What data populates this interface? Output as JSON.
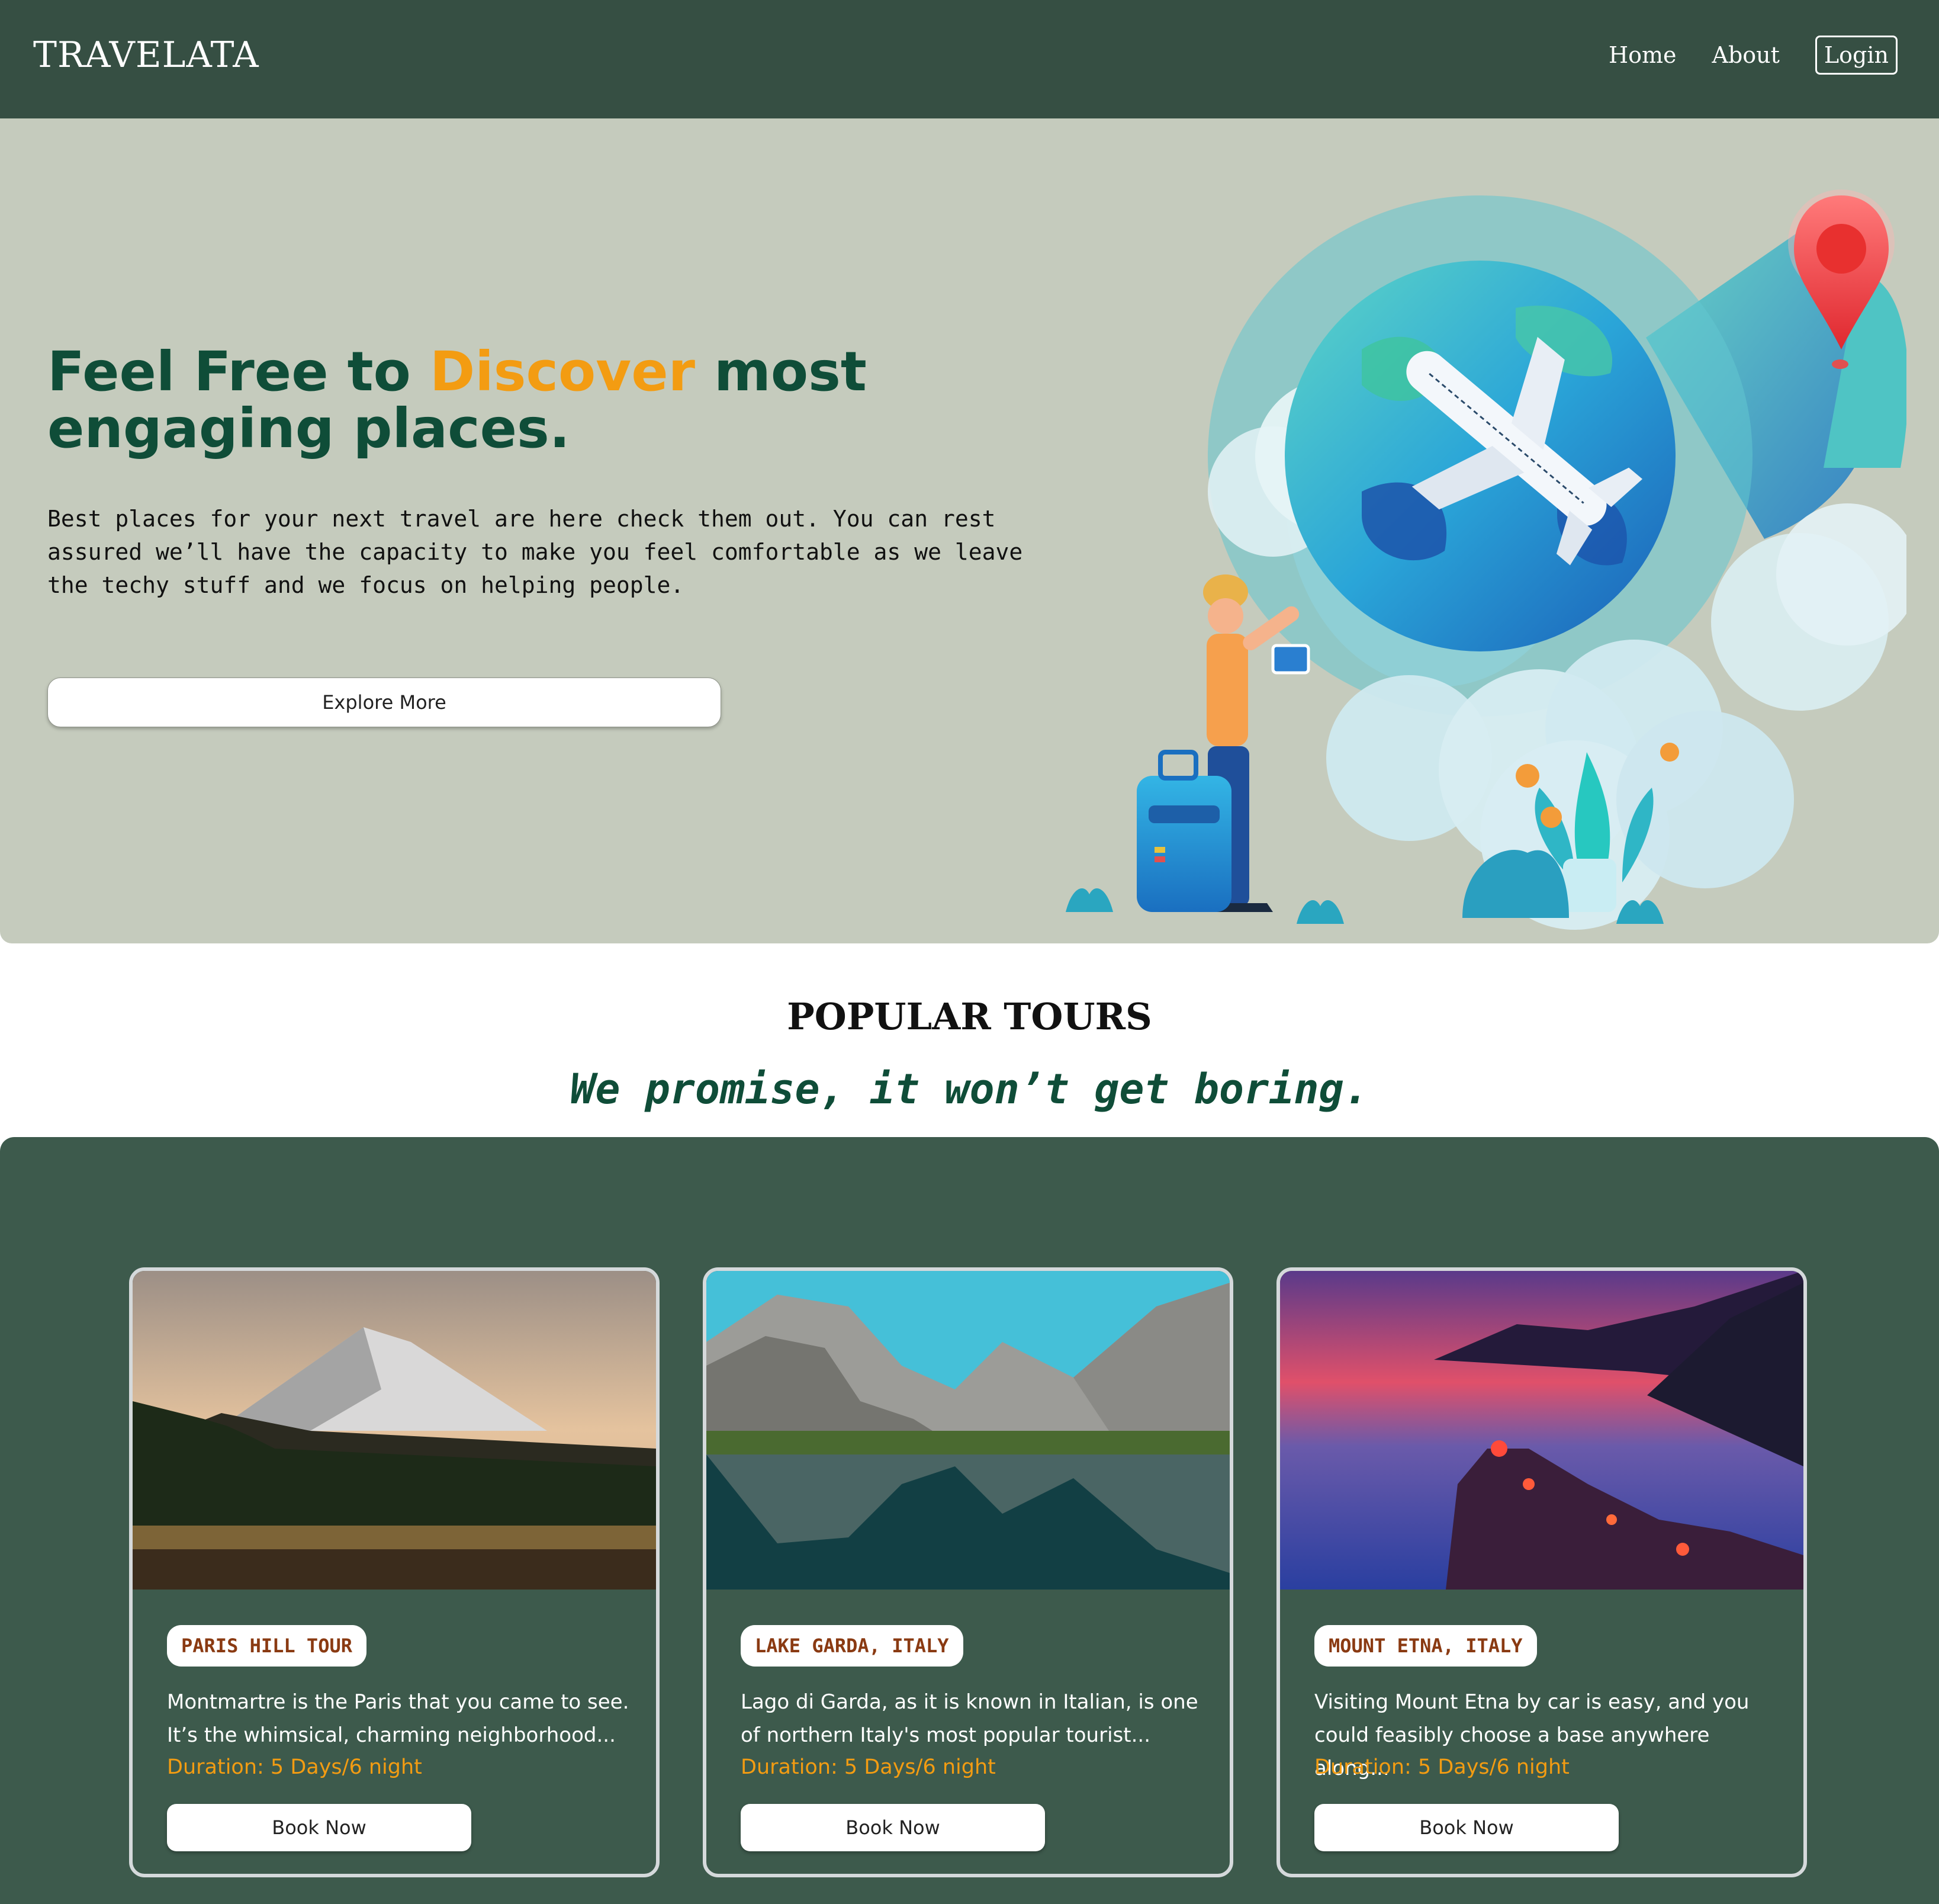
{
  "nav": {
    "brand": "TRAVELATA",
    "links": [
      "Home",
      "About",
      "Login"
    ]
  },
  "hero": {
    "title_before": "Feel Free to ",
    "title_accent": "Discover",
    "title_after": " most engaging places.",
    "text": "Best places for your next travel are here check them out. You can rest assured we’ll have the capacity to make you feel comfortable as we leave the techy stuff and we focus on helping people.",
    "button": "Explore More"
  },
  "section": {
    "title": "POPULAR TOURS",
    "subtitle": "We promise, it won’t get boring."
  },
  "tours": [
    {
      "tag": "PARIS HILL TOUR",
      "description": "Montmartre is the Paris that you came to see. It’s the whimsical, charming neighborhood...",
      "duration": "Duration: 5 Days/6 night",
      "button": "Book Now"
    },
    {
      "tag": "LAKE GARDA, ITALY",
      "description": "Lago di Garda, as it is known in Italian, is one of northern Italy's most popular tourist...",
      "duration": "Duration: 5 Days/6 night",
      "button": "Book Now"
    },
    {
      "tag": "MOUNT ETNA, ITALY",
      "description": "Visiting Mount Etna by car is easy, and you could feasibly choose a base anywhere along...",
      "duration": "Duration: 5 Days/6 night",
      "button": "Book Now"
    }
  ],
  "colors": {
    "nav_bg": "#364f43",
    "hero_bg": "#c5cbbd",
    "heading_green": "#0f4d38",
    "accent_orange": "#f39c12",
    "tours_bg": "#3d5a4c",
    "tag_text": "#8a3a12"
  }
}
